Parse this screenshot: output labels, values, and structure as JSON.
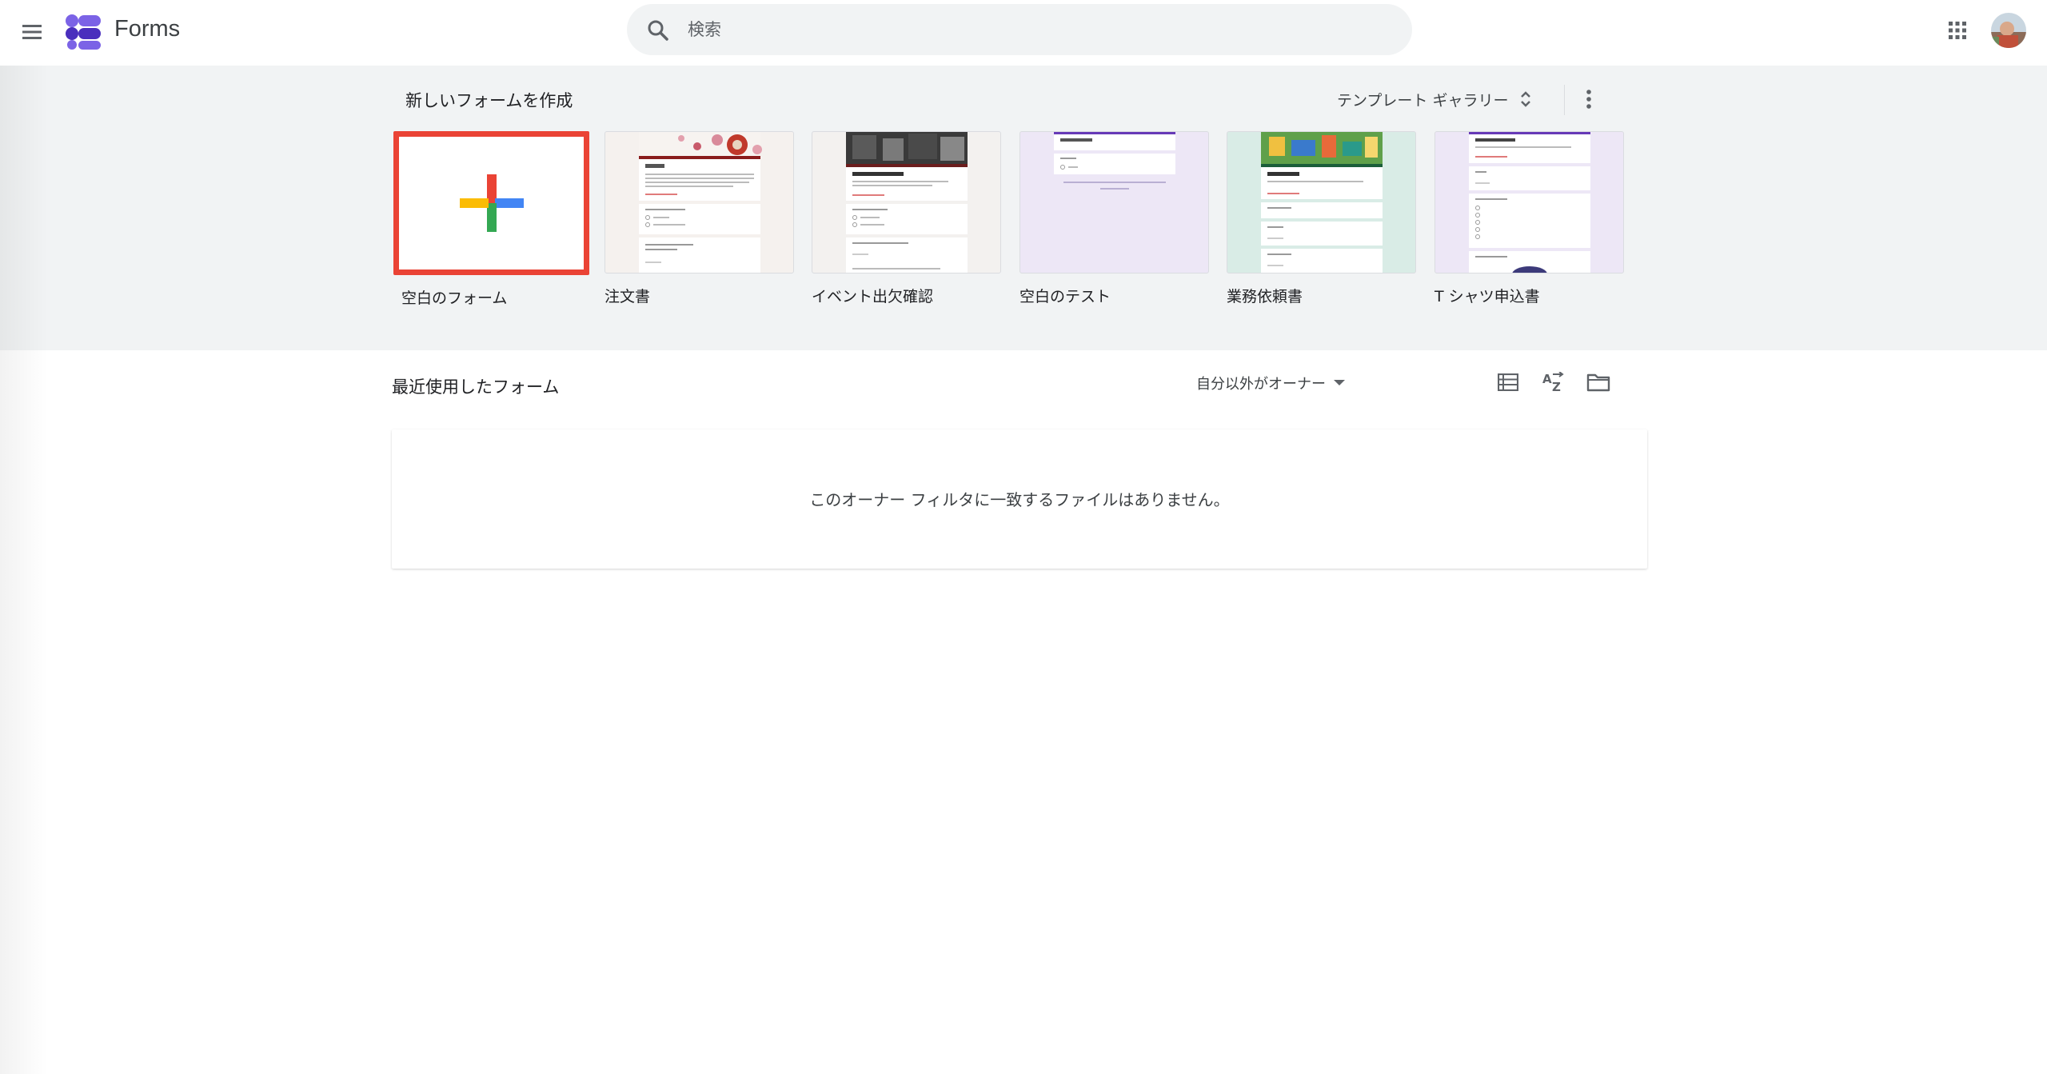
{
  "header": {
    "app_title": "Forms",
    "search_placeholder": "検索",
    "menu_icon": "hamburger-menu-icon",
    "apps_icon": "apps-grid-icon"
  },
  "templates": {
    "title": "新しいフォームを作成",
    "gallery_label": "テンプレート ギャラリー",
    "items": [
      {
        "label": "空白のフォーム",
        "icon": "plus-icon"
      },
      {
        "label": "注文書"
      },
      {
        "label": "イベント出欠確認"
      },
      {
        "label": "空白のテスト"
      },
      {
        "label": "業務依頼書"
      },
      {
        "label": "T シャツ申込書"
      }
    ]
  },
  "recent": {
    "title": "最近使用したフォーム",
    "owner_filter": "自分以外がオーナー",
    "empty_message": "このオーナー フィルタに一致するファイルはありません。"
  },
  "colors": {
    "accent_red": "#ea4335",
    "blue": "#4285f4",
    "green": "#34a853",
    "yellow": "#fbbc04",
    "forms_purple": "#673ab7"
  }
}
